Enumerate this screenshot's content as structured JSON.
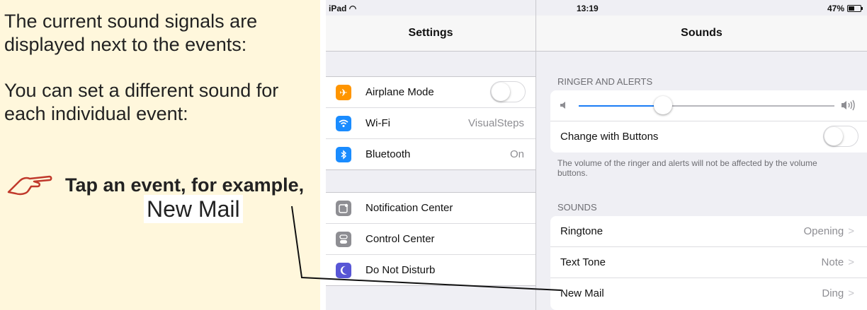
{
  "guide": {
    "intro": "The current sound signals are displayed next to the events:",
    "instruction": "You can set a different sound for each individual event:",
    "action_text": "Tap an event, for example,",
    "target_label": "New Mail"
  },
  "status": {
    "device": "iPad",
    "time": "13:19",
    "battery": "47%"
  },
  "master": {
    "title": "Settings",
    "group1": [
      {
        "label": "Airplane Mode",
        "icon": "airplane-icon",
        "color": "#ff9500",
        "toggle": false
      },
      {
        "label": "Wi-Fi",
        "value": "VisualSteps",
        "icon": "wifi-icon",
        "color": "#1a8cff"
      },
      {
        "label": "Bluetooth",
        "value": "On",
        "icon": "bluetooth-icon",
        "color": "#1a8cff"
      }
    ],
    "group2": [
      {
        "label": "Notification Center",
        "icon": "notification-center-icon",
        "color": "#8e8e93"
      },
      {
        "label": "Control Center",
        "icon": "control-center-icon",
        "color": "#8e8e93"
      },
      {
        "label": "Do Not Disturb",
        "icon": "moon-icon",
        "color": "#5856d6"
      }
    ]
  },
  "detail": {
    "title": "Sounds",
    "ringer_section": "RINGER AND ALERTS",
    "ringer_volume": 0.33,
    "change_with_buttons": "Change with Buttons",
    "change_with_buttons_on": false,
    "note": "The volume of the ringer and alerts will not be affected by the volume buttons.",
    "sounds_section": "SOUNDS",
    "sounds": [
      {
        "label": "Ringtone",
        "value": "Opening"
      },
      {
        "label": "Text Tone",
        "value": "Note"
      },
      {
        "label": "New Mail",
        "value": "Ding"
      }
    ],
    "accent_color": "#1a7cf5"
  }
}
